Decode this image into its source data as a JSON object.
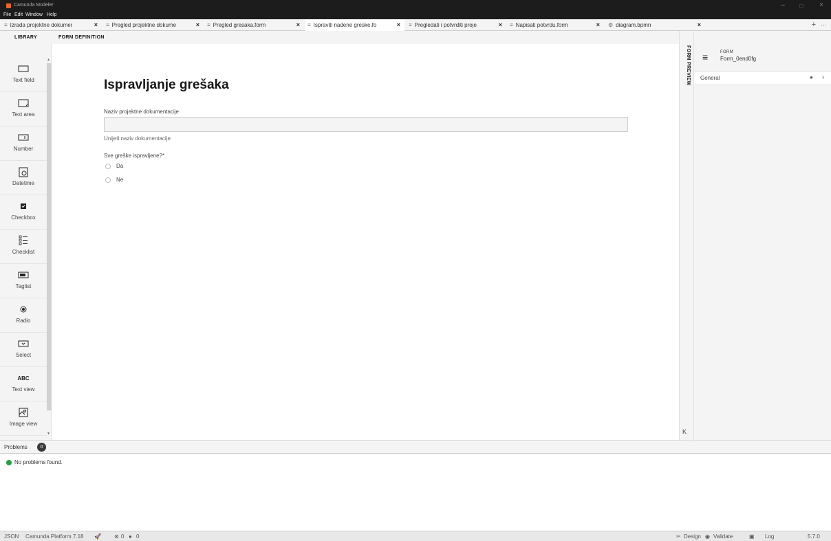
{
  "app": {
    "title": "Camunda Modeler",
    "accent": "#e5662a"
  },
  "menu": [
    "File",
    "Edit",
    "Window",
    "Help"
  ],
  "tabs": [
    {
      "label": "Izrada projektne dokumer",
      "icon": "form-icon",
      "active": false
    },
    {
      "label": "Pregled projektne dokume",
      "icon": "form-icon",
      "active": false
    },
    {
      "label": "Pregled gresaka.form",
      "icon": "form-icon",
      "active": false
    },
    {
      "label": "Ispraviti nadene greske.fo",
      "icon": "form-icon",
      "active": true
    },
    {
      "label": "Pregledati i potvrditi proje",
      "icon": "form-icon",
      "active": false
    },
    {
      "label": "Napisati potvrdu.form",
      "icon": "form-icon",
      "active": false
    },
    {
      "label": "diagram.bpmn",
      "icon": "gear-icon",
      "active": false
    }
  ],
  "tab_close": "×",
  "library": {
    "title": "LIBRARY",
    "items": [
      {
        "label": "Text field",
        "icon": "text-field-icon"
      },
      {
        "label": "Text area",
        "icon": "text-area-icon"
      },
      {
        "label": "Number",
        "icon": "number-icon"
      },
      {
        "label": "Datetime",
        "icon": "datetime-icon"
      },
      {
        "label": "Checkbox",
        "icon": "checkbox-icon"
      },
      {
        "label": "Checklist",
        "icon": "checklist-icon"
      },
      {
        "label": "Taglist",
        "icon": "taglist-icon"
      },
      {
        "label": "Radio",
        "icon": "radio-icon"
      },
      {
        "label": "Select",
        "icon": "select-icon"
      },
      {
        "label": "Text view",
        "icon": "text-view-icon"
      },
      {
        "label": "Image view",
        "icon": "image-view-icon"
      }
    ]
  },
  "canvas": {
    "header": "FORM DEFINITION",
    "form_title": "Ispravljanje grešaka",
    "field1": {
      "label": "Naziv projektne dokumentacije",
      "value": "",
      "description": "Unijeti naziv dokumentacije"
    },
    "radio_group": {
      "label": "Sve greške ispravljene?*",
      "options": [
        "Da",
        "Ne"
      ]
    }
  },
  "preview": {
    "label": "FORM PREVIEW",
    "collapse": "K"
  },
  "properties": {
    "type": "FORM",
    "name": "Form_0end0fg",
    "group": "General"
  },
  "problems": {
    "label": "Problems",
    "count": "0",
    "message": "No problems found."
  },
  "status": {
    "json": "JSON",
    "platform": "Camunda Platform 7.18",
    "errors": "0",
    "warnings": "0",
    "design": "Design",
    "validate": "Validate",
    "log": "Log",
    "version": "5.7.0"
  }
}
